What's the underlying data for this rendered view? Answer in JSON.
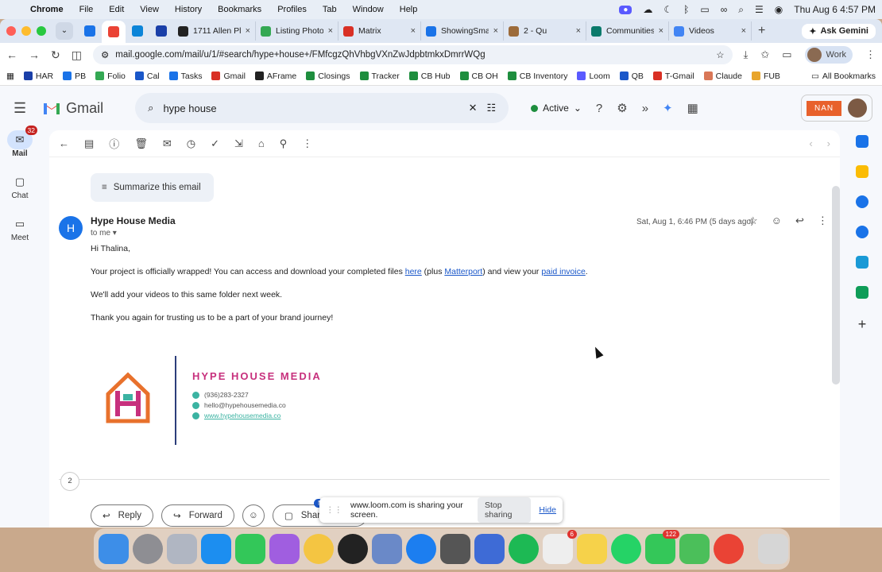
{
  "menubar": {
    "items": [
      "Chrome",
      "File",
      "Edit",
      "View",
      "History",
      "Bookmarks",
      "Profiles",
      "Tab",
      "Window",
      "Help"
    ],
    "datetime": "Thu Aug 6  4:57 PM"
  },
  "tabs": [
    {
      "label": "1711 Allen Pl",
      "color": "#222222"
    },
    {
      "label": "Listing Photo",
      "color": "#34a853"
    },
    {
      "label": "Matrix",
      "color": "#d93025"
    },
    {
      "label": "ShowingSmart",
      "color": "#1a73e8"
    },
    {
      "label": "2 - Qu",
      "color": "#9c6b3a"
    },
    {
      "label": "Communities",
      "color": "#0b7a6b"
    },
    {
      "label": "Videos",
      "color": "#4285f4"
    }
  ],
  "ask_gemini": "Ask Gemini",
  "url": "mail.google.com/mail/u/1/#search/hype+house+/FMfcgzQhVhbgVXnZwJdpbtmkxDmrrWQg",
  "profile": "Work",
  "bookmarks": [
    {
      "label": "HAR",
      "color": "#1a3fa8"
    },
    {
      "label": "PB",
      "color": "#1a73e8"
    },
    {
      "label": "Folio",
      "color": "#34a853"
    },
    {
      "label": "Cal",
      "color": "#1a57c9"
    },
    {
      "label": "Tasks",
      "color": "#1a73e8"
    },
    {
      "label": "Gmail",
      "color": "#d93025"
    },
    {
      "label": "AFrame",
      "color": "#222"
    },
    {
      "label": "Closings",
      "color": "#1e8e3e"
    },
    {
      "label": "Tracker",
      "color": "#1e8e3e"
    },
    {
      "label": "CB Hub",
      "color": "#1e8e3e"
    },
    {
      "label": "CB OH",
      "color": "#1e8e3e"
    },
    {
      "label": "CB Inventory",
      "color": "#1e8e3e"
    },
    {
      "label": "Loom",
      "color": "#5a5aff"
    },
    {
      "label": "QB",
      "color": "#1a57c9"
    },
    {
      "label": "T-Gmail",
      "color": "#d93025"
    },
    {
      "label": "Claude",
      "color": "#d97757"
    },
    {
      "label": "FUB",
      "color": "#e8a52c"
    }
  ],
  "all_bookmarks": "All Bookmarks",
  "gmail": {
    "logo_text": "Gmail",
    "search_value": "hype house",
    "status": "Active",
    "account_badge": "NAN",
    "rail": [
      {
        "label": "Mail",
        "badge": "32"
      },
      {
        "label": "Chat"
      },
      {
        "label": "Meet"
      }
    ]
  },
  "email": {
    "summarize_label": "Summarize this email",
    "sender_initial": "H",
    "sender": "Hype House Media",
    "to": "to me",
    "date": "Sat, Aug 1, 6:46 PM (5 days ago)",
    "greeting": "Hi Thalina,",
    "p1_a": "Your project is officially wrapped! You can access and download your completed files ",
    "p1_link1": "here",
    "p1_b": " (plus ",
    "p1_link2": "Matterport",
    "p1_c": ") and view your ",
    "p1_link3": "paid invoice",
    "p1_d": ".",
    "p2": "We'll add your videos to this same folder next week.",
    "p3": "Thank you again for trusting us to be a part of your brand journey!",
    "signature": {
      "brand": "HYPE HOUSE MEDIA",
      "phone": "(936)283-2327",
      "email": "hello@hypehousemedia.co",
      "website": "www.hypehousemedia.co"
    },
    "thread_count": "2",
    "reply": "Reply",
    "forward": "Forward",
    "share_chat": "Share in chat",
    "new_tag": "New"
  },
  "loom": {
    "message": "www.loom.com is sharing your screen.",
    "stop": "Stop sharing",
    "hide": "Hide"
  },
  "dock": {
    "apps": [
      {
        "name": "finder",
        "color": "#3d8ee8"
      },
      {
        "name": "settings",
        "color": "#8e8e93"
      },
      {
        "name": "launchpad",
        "color": "#b0b6c2"
      },
      {
        "name": "app-store",
        "color": "#1c8ef0"
      },
      {
        "name": "facetime",
        "color": "#33c759"
      },
      {
        "name": "podcasts",
        "color": "#a05ee0"
      },
      {
        "name": "photos",
        "color": "#f4c542"
      },
      {
        "name": "clock",
        "color": "#222"
      },
      {
        "name": "preview",
        "color": "#6a89c8"
      },
      {
        "name": "quicktime",
        "color": "#1c7ef0"
      },
      {
        "name": "calculator",
        "color": "#555"
      },
      {
        "name": "loom",
        "color": "#3e6bd6"
      },
      {
        "name": "spotify",
        "color": "#1db954"
      },
      {
        "name": "reminders",
        "color": "#eee",
        "badge": "6"
      },
      {
        "name": "notes",
        "color": "#f6d24a"
      },
      {
        "name": "whatsapp",
        "color": "#25d366"
      },
      {
        "name": "messages",
        "color": "#34c759",
        "badge": "122"
      },
      {
        "name": "mail-check",
        "color": "#4bbf5a"
      },
      {
        "name": "chrome",
        "color": "#ea4335"
      }
    ]
  }
}
